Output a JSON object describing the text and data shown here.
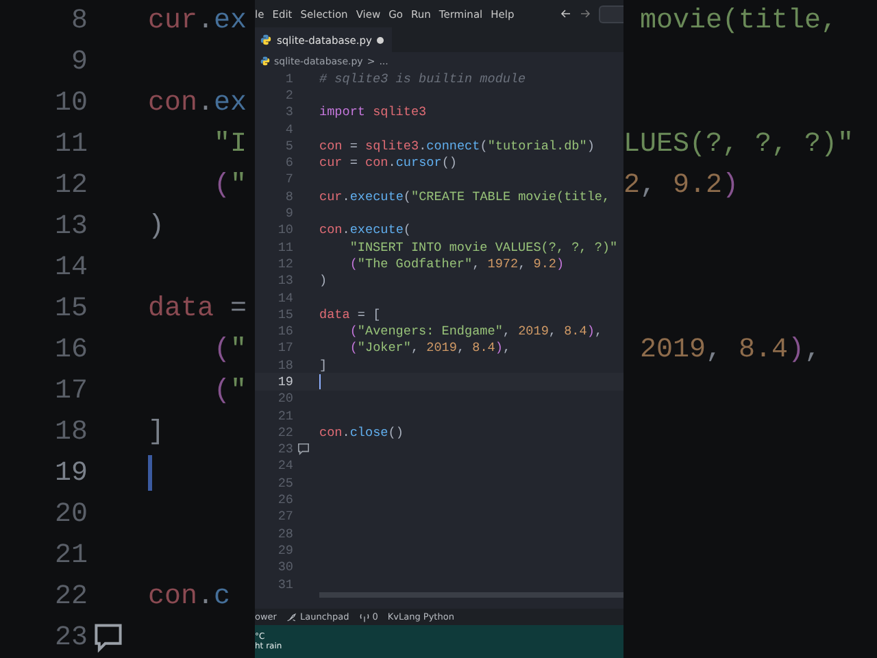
{
  "backdrop": {
    "lines": [
      {
        "number": "8",
        "tokens": [
          {
            "kind": "variable",
            "text": "cur"
          },
          {
            "kind": "punct",
            "text": "."
          },
          {
            "kind": "function",
            "text": "ex"
          }
        ],
        "tail": [
          {
            "kind": "string",
            "text": " movie(title,"
          }
        ]
      },
      {
        "number": "9"
      },
      {
        "number": "10",
        "tokens": [
          {
            "kind": "variable",
            "text": "con"
          },
          {
            "kind": "punct",
            "text": "."
          },
          {
            "kind": "function",
            "text": "ex"
          }
        ]
      },
      {
        "number": "11",
        "tokens": [
          {
            "kind": "string",
            "text": "    \"I"
          }
        ],
        "tail": [
          {
            "kind": "string",
            "text": "LUES(?, ?, ?)\""
          }
        ]
      },
      {
        "number": "12",
        "tokens": [
          {
            "kind": "bracket",
            "text": "    ("
          },
          {
            "kind": "string",
            "text": "\""
          }
        ],
        "tail": [
          {
            "kind": "number",
            "text": "2"
          },
          {
            "kind": "punct",
            "text": ", "
          },
          {
            "kind": "number",
            "text": "9.2"
          },
          {
            "kind": "bracket",
            "text": ")"
          }
        ]
      },
      {
        "number": "13",
        "tokens": [
          {
            "kind": "punct",
            "text": ")"
          }
        ]
      },
      {
        "number": "14"
      },
      {
        "number": "15",
        "tokens": [
          {
            "kind": "variable",
            "text": "data"
          },
          {
            "kind": "punct",
            "text": " ="
          }
        ]
      },
      {
        "number": "16",
        "tokens": [
          {
            "kind": "bracket",
            "text": "    ("
          },
          {
            "kind": "string",
            "text": "\""
          }
        ],
        "tail": [
          {
            "kind": "number",
            "text": " 2019"
          },
          {
            "kind": "punct",
            "text": ", "
          },
          {
            "kind": "number",
            "text": "8.4"
          },
          {
            "kind": "bracket",
            "text": ")"
          },
          {
            "kind": "punct",
            "text": ","
          }
        ]
      },
      {
        "number": "17",
        "tokens": [
          {
            "kind": "bracket",
            "text": "    ("
          },
          {
            "kind": "string",
            "text": "\""
          }
        ]
      },
      {
        "number": "18",
        "tokens": [
          {
            "kind": "punct",
            "text": "]"
          }
        ]
      },
      {
        "number": "19",
        "current": true
      },
      {
        "number": "20"
      },
      {
        "number": "21"
      },
      {
        "number": "22",
        "tokens": [
          {
            "kind": "variable",
            "text": "con"
          },
          {
            "kind": "punct",
            "text": "."
          },
          {
            "kind": "function",
            "text": "c"
          }
        ]
      },
      {
        "number": "23",
        "comment_marker": true
      }
    ]
  },
  "window": {
    "menu": [
      "le",
      "Edit",
      "Selection",
      "View",
      "Go",
      "Run",
      "Terminal",
      "Help"
    ],
    "tab": {
      "label": "sqlite-database.py",
      "modified": true
    },
    "breadcrumb": {
      "file": "sqlite-database.py",
      "separator": ">",
      "rest": "..."
    },
    "lines": [
      {
        "number": "1",
        "tokens": [
          {
            "kind": "comment",
            "text": "# sqlite3 is builtin module"
          }
        ]
      },
      {
        "number": "2"
      },
      {
        "number": "3",
        "tokens": [
          {
            "kind": "keyword",
            "text": "import"
          },
          {
            "kind": "variable",
            "text": " sqlite3"
          }
        ]
      },
      {
        "number": "4"
      },
      {
        "number": "5",
        "tokens": [
          {
            "kind": "variable",
            "text": "con"
          },
          {
            "kind": "punct",
            "text": " = "
          },
          {
            "kind": "variable",
            "text": "sqlite3"
          },
          {
            "kind": "punct",
            "text": "."
          },
          {
            "kind": "function",
            "text": "connect"
          },
          {
            "kind": "punct",
            "text": "("
          },
          {
            "kind": "string",
            "text": "\"tutorial.db\""
          },
          {
            "kind": "punct",
            "text": ")"
          }
        ]
      },
      {
        "number": "6",
        "tokens": [
          {
            "kind": "variable",
            "text": "cur"
          },
          {
            "kind": "punct",
            "text": " = "
          },
          {
            "kind": "variable",
            "text": "con"
          },
          {
            "kind": "punct",
            "text": "."
          },
          {
            "kind": "function",
            "text": "cursor"
          },
          {
            "kind": "punct",
            "text": "()"
          }
        ]
      },
      {
        "number": "7"
      },
      {
        "number": "8",
        "tokens": [
          {
            "kind": "variable",
            "text": "cur"
          },
          {
            "kind": "punct",
            "text": "."
          },
          {
            "kind": "function",
            "text": "execute"
          },
          {
            "kind": "punct",
            "text": "("
          },
          {
            "kind": "string",
            "text": "\"CREATE TABLE movie(title,"
          }
        ]
      },
      {
        "number": "9"
      },
      {
        "number": "10",
        "tokens": [
          {
            "kind": "variable",
            "text": "con"
          },
          {
            "kind": "punct",
            "text": "."
          },
          {
            "kind": "function",
            "text": "execute"
          },
          {
            "kind": "punct",
            "text": "("
          }
        ]
      },
      {
        "number": "11",
        "tokens": [
          {
            "kind": "string",
            "text": "    \"INSERT INTO movie VALUES(?, ?, ?)\""
          }
        ]
      },
      {
        "number": "12",
        "tokens": [
          {
            "kind": "bracket",
            "text": "    ("
          },
          {
            "kind": "string",
            "text": "\"The Godfather\""
          },
          {
            "kind": "punct",
            "text": ", "
          },
          {
            "kind": "number",
            "text": "1972"
          },
          {
            "kind": "punct",
            "text": ", "
          },
          {
            "kind": "number",
            "text": "9.2"
          },
          {
            "kind": "bracket",
            "text": ")"
          }
        ]
      },
      {
        "number": "13",
        "tokens": [
          {
            "kind": "punct",
            "text": ")"
          }
        ]
      },
      {
        "number": "14"
      },
      {
        "number": "15",
        "tokens": [
          {
            "kind": "variable",
            "text": "data"
          },
          {
            "kind": "punct",
            "text": " = ["
          }
        ]
      },
      {
        "number": "16",
        "tokens": [
          {
            "kind": "bracket",
            "text": "    ("
          },
          {
            "kind": "string",
            "text": "\"Avengers: Endgame\""
          },
          {
            "kind": "punct",
            "text": ", "
          },
          {
            "kind": "number",
            "text": "2019"
          },
          {
            "kind": "punct",
            "text": ", "
          },
          {
            "kind": "number",
            "text": "8.4"
          },
          {
            "kind": "bracket",
            "text": ")"
          },
          {
            "kind": "punct",
            "text": ","
          }
        ]
      },
      {
        "number": "17",
        "tokens": [
          {
            "kind": "bracket",
            "text": "    ("
          },
          {
            "kind": "string",
            "text": "\"Joker\""
          },
          {
            "kind": "punct",
            "text": ", "
          },
          {
            "kind": "number",
            "text": "2019"
          },
          {
            "kind": "punct",
            "text": ", "
          },
          {
            "kind": "number",
            "text": "8.4"
          },
          {
            "kind": "bracket",
            "text": ")"
          },
          {
            "kind": "punct",
            "text": ","
          }
        ]
      },
      {
        "number": "18",
        "tokens": [
          {
            "kind": "punct",
            "text": "]"
          }
        ]
      },
      {
        "number": "19",
        "current": true
      },
      {
        "number": "20"
      },
      {
        "number": "21"
      },
      {
        "number": "22",
        "tokens": [
          {
            "kind": "variable",
            "text": "con"
          },
          {
            "kind": "punct",
            "text": "."
          },
          {
            "kind": "function",
            "text": "close"
          },
          {
            "kind": "punct",
            "text": "()"
          }
        ]
      },
      {
        "number": "23",
        "comment_marker": true
      },
      {
        "number": "24"
      },
      {
        "number": "25"
      },
      {
        "number": "26"
      },
      {
        "number": "27"
      },
      {
        "number": "28"
      },
      {
        "number": "29"
      },
      {
        "number": "30"
      },
      {
        "number": "31"
      }
    ],
    "status_bar": [
      {
        "kind": "text",
        "text": "ower"
      },
      {
        "kind": "launch",
        "text": "Launchpad"
      },
      {
        "kind": "ports",
        "text": "0"
      },
      {
        "kind": "text",
        "text": "KvLang Python"
      }
    ],
    "weather": {
      "temperature": "°C",
      "condition": "ht rain"
    }
  }
}
